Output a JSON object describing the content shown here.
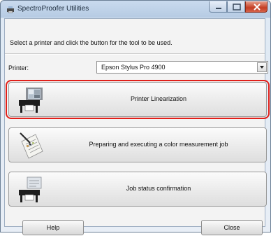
{
  "window": {
    "title": "SpectroProofer Utilities"
  },
  "instruction": "Select a printer and click the button for the tool to be used.",
  "printer": {
    "label": "Printer:",
    "selected": "Epson Stylus Pro 4900"
  },
  "tools": [
    {
      "label": "Printer Linearization",
      "icon": "printer-chart-icon"
    },
    {
      "label": "Preparing and executing a color measurement job",
      "icon": "clipboard-pen-icon"
    },
    {
      "label": "Job status confirmation",
      "icon": "printer-check-icon"
    }
  ],
  "buttons": {
    "help": "Help",
    "close": "Close"
  },
  "colors": {
    "highlight": "#e0201a",
    "close_button": "#c43d23"
  }
}
